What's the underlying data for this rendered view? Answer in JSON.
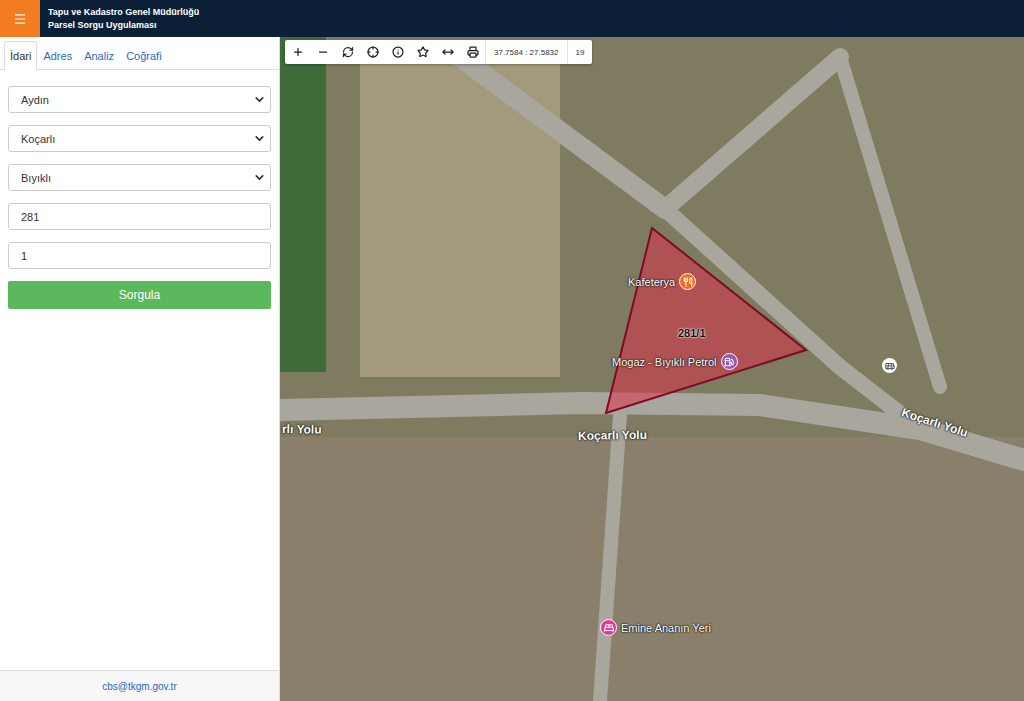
{
  "header": {
    "title": "Tapu ve Kadastro Genel Müdürlüğü",
    "subtitle": "Parsel Sorgu Uygulaması"
  },
  "tabs": [
    {
      "label": "İdari",
      "selected": true
    },
    {
      "label": "Adres",
      "selected": false
    },
    {
      "label": "Analiz",
      "selected": false
    },
    {
      "label": "Coğrafi",
      "selected": false
    }
  ],
  "form": {
    "fields": [
      {
        "kind": "select",
        "value": "Aydın"
      },
      {
        "kind": "select",
        "value": "Koçarlı"
      },
      {
        "kind": "select",
        "value": "Bıyıklı"
      },
      {
        "kind": "input",
        "value": "281"
      },
      {
        "kind": "input",
        "value": "1"
      }
    ],
    "submit": "Sorgula"
  },
  "footer": {
    "email": "cbs@tkgm.gov.tr"
  },
  "map": {
    "toolbar": {
      "coordinates": "37.7584 : 27.5832",
      "zoom": "19"
    },
    "parcel": {
      "label": "281/1"
    },
    "pois": [
      {
        "name": "Kafeterya",
        "color": "#f26d21"
      },
      {
        "name": "Mogaz - Bıyıklı Petrol",
        "color": "#8e5bb5"
      },
      {
        "name": "Emine Ananın Yeri",
        "color": "#e63a9a"
      }
    ],
    "roads": [
      {
        "name": "rlı Yolu"
      },
      {
        "name": "Koçarlı Yolu"
      },
      {
        "name": "Koçarlı Yolu"
      }
    ]
  }
}
